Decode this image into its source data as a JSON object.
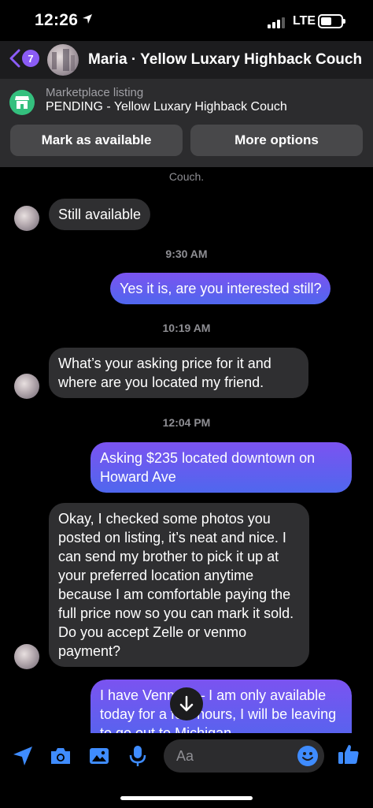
{
  "status_bar": {
    "time": "12:26",
    "network": "LTE"
  },
  "header": {
    "unread_count": "7",
    "title": "Maria · Yellow Luxary Highback Couch"
  },
  "listing": {
    "subtitle": "Marketplace listing",
    "title": "PENDING - Yellow Luxary Highback Couch",
    "mark_available_label": "Mark as available",
    "more_options_label": "More options"
  },
  "messages": {
    "partial_top": "Couch.",
    "m1": "Still available",
    "t1": "9:30 AM",
    "m2": "Yes it is, are you interested still?",
    "t2": "10:19 AM",
    "m3": "What’s your asking price for it and where are you located my friend.",
    "t3": "12:04 PM",
    "m4": "Asking $235 located downtown on Howard Ave",
    "m5": "Okay, I checked some photos you posted on listing, it’s neat and nice. I can send my brother to pick it up at your preferred location anytime because I am comfortable paying the full price now so you can mark it sold. Do you accept Zelle or venmo payment?",
    "m6": "I have Venmo — I am only available today for a few hours, I will be leaving to go out to Michigan"
  },
  "composer": {
    "placeholder": "Aa"
  },
  "colors": {
    "outgoing_start": "#7b53f0",
    "outgoing_end": "#4f67ee",
    "incoming": "#2f2f31",
    "accent": "#3f8cff",
    "listing_icon": "#34c07e"
  }
}
